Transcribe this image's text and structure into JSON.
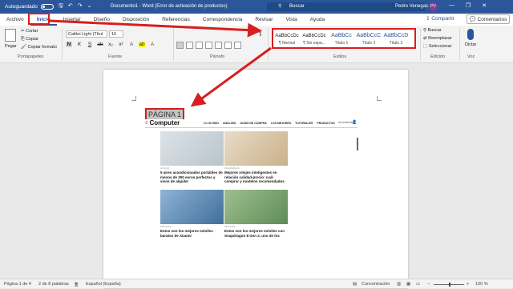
{
  "titlebar": {
    "autosave_label": "Autoguardado",
    "document_title": "Documento1 - Word (Error de activación de productos)",
    "search_placeholder": "Buscar",
    "user_name": "Pedro Venegas",
    "user_initials": "PV",
    "minimize": "—",
    "maximize": "❐",
    "close": "✕"
  },
  "tabs": [
    "Archivo",
    "Inicio",
    "Insertar",
    "Diseño",
    "Disposición",
    "Referencias",
    "Correspondencia",
    "Revisar",
    "Vista",
    "Ayuda"
  ],
  "actions": {
    "share": "Compartir",
    "comments": "Comentarios"
  },
  "ribbon": {
    "clipboard": {
      "paste": "Pegar",
      "cut": "Cortar",
      "copy": "Copiar",
      "format_painter": "Copiar formato",
      "label": "Portapapeles"
    },
    "font": {
      "name": "Calibri Light (Títul",
      "size": "16",
      "label": "Fuente"
    },
    "paragraph": {
      "label": "Párrafo"
    },
    "styles": {
      "items": [
        {
          "sample": "AaBbCcDc",
          "name": "¶ Normal"
        },
        {
          "sample": "AaBbCcDc",
          "name": "¶ Sin espa..."
        },
        {
          "sample": "AaBbCc",
          "name": "Título 1"
        },
        {
          "sample": "AaBbCcC",
          "name": "Título 2"
        },
        {
          "sample": "AaBbCcD",
          "name": "Título 3"
        }
      ],
      "label": "Estilos"
    },
    "editing": {
      "find": "Buscar",
      "replace": "Reemplazar",
      "select": "Seleccionar",
      "label": "Edición"
    },
    "voice": {
      "dictate": "Dictar",
      "label": "Voz"
    }
  },
  "document": {
    "heading": "PÁGINA 1",
    "web": {
      "logo": "Computer",
      "nav": [
        "LO ÚLTIMO",
        "ANÁLISIS",
        "GUÍAS DE COMPRA",
        "LOS MEJORES",
        "TUTORIALES",
        "PRODUCTOS"
      ],
      "nav_right": "Accesibilidad",
      "articles": [
        {
          "section": "HOGAR",
          "title": "5 aires acondicionados portátiles de menos de 300 euros perfectos y vivos de alquiler"
        },
        {
          "section": "WEARABLES",
          "title": "Mejores relojes inteligentes en relación calidad-precio: cuál comprar y modelos recomendados"
        },
        {
          "section": "MÓVILES",
          "title": "Estos son los mejores móviles baratos de Xiaomi"
        },
        {
          "section": "MÓVILES",
          "title": "Estos son los mejores móviles con Snapdragon 8 Gen 2, uno de los"
        }
      ]
    }
  },
  "status": {
    "page": "Página 1 de 4",
    "words": "2 de 8 palabras",
    "language": "Español (España)",
    "focus": "Concentración",
    "zoom": "100 %"
  },
  "colors": {
    "accent": "#2b579a",
    "annotation": "#d81e1e"
  }
}
